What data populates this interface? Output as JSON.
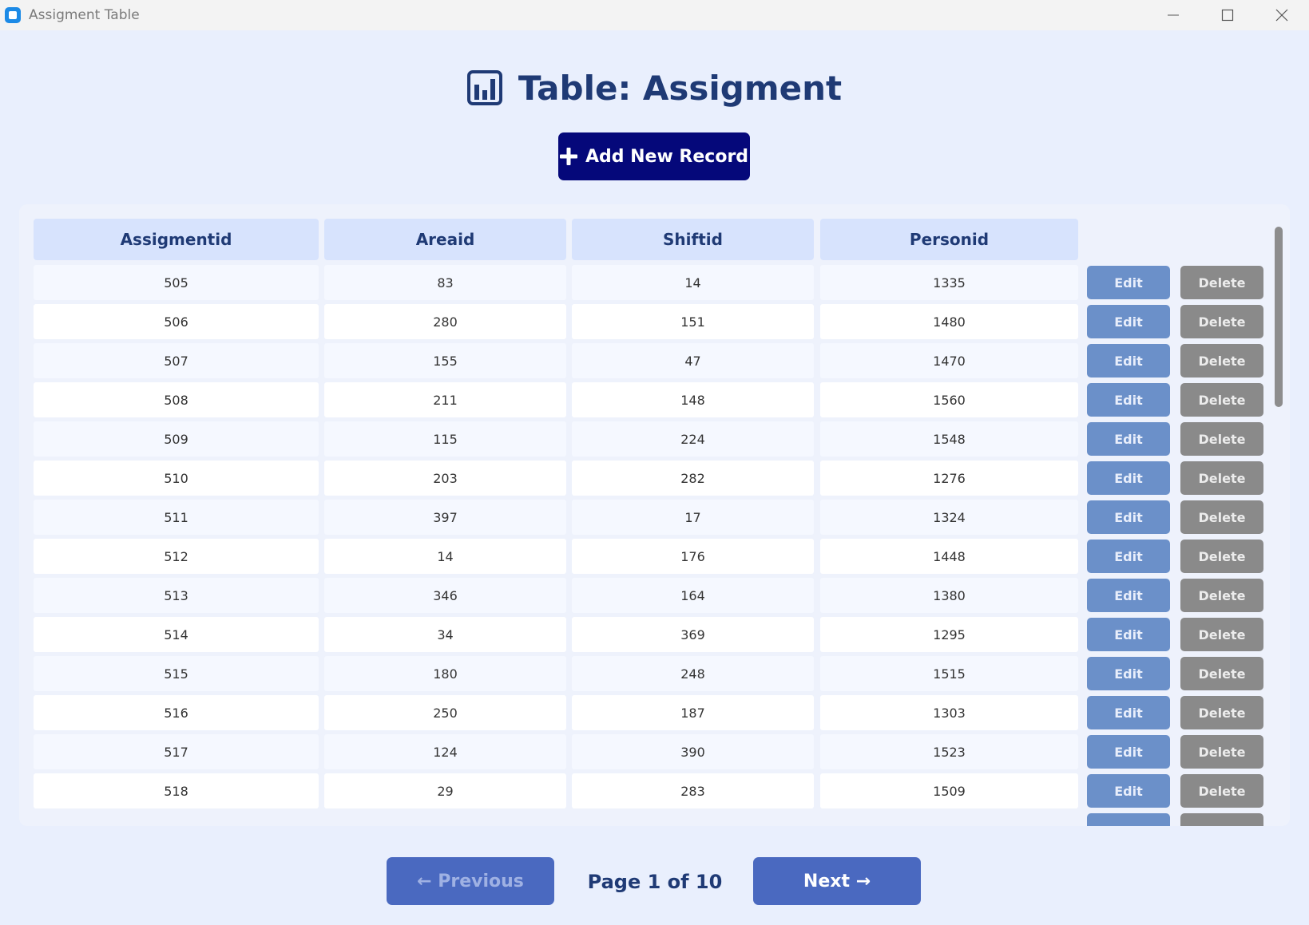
{
  "window": {
    "title": "Assigment Table"
  },
  "header": {
    "icon": "bar-chart-icon",
    "title": "Table: Assigment"
  },
  "toolbar": {
    "add_label": "Add New Record",
    "add_icon": "plus-icon"
  },
  "table": {
    "columns": [
      "Assigmentid",
      "Areaid",
      "Shiftid",
      "Personid"
    ],
    "rows": [
      {
        "assigmentid": "505",
        "areaid": "83",
        "shiftid": "14",
        "personid": "1335",
        "edit": "Edit",
        "delete": "Delete"
      },
      {
        "assigmentid": "506",
        "areaid": "280",
        "shiftid": "151",
        "personid": "1480",
        "edit": "Edit",
        "delete": "Delete"
      },
      {
        "assigmentid": "507",
        "areaid": "155",
        "shiftid": "47",
        "personid": "1470",
        "edit": "Edit",
        "delete": "Delete"
      },
      {
        "assigmentid": "508",
        "areaid": "211",
        "shiftid": "148",
        "personid": "1560",
        "edit": "Edit",
        "delete": "Delete"
      },
      {
        "assigmentid": "509",
        "areaid": "115",
        "shiftid": "224",
        "personid": "1548",
        "edit": "Edit",
        "delete": "Delete"
      },
      {
        "assigmentid": "510",
        "areaid": "203",
        "shiftid": "282",
        "personid": "1276",
        "edit": "Edit",
        "delete": "Delete"
      },
      {
        "assigmentid": "511",
        "areaid": "397",
        "shiftid": "17",
        "personid": "1324",
        "edit": "Edit",
        "delete": "Delete"
      },
      {
        "assigmentid": "512",
        "areaid": "14",
        "shiftid": "176",
        "personid": "1448",
        "edit": "Edit",
        "delete": "Delete"
      },
      {
        "assigmentid": "513",
        "areaid": "346",
        "shiftid": "164",
        "personid": "1380",
        "edit": "Edit",
        "delete": "Delete"
      },
      {
        "assigmentid": "514",
        "areaid": "34",
        "shiftid": "369",
        "personid": "1295",
        "edit": "Edit",
        "delete": "Delete"
      },
      {
        "assigmentid": "515",
        "areaid": "180",
        "shiftid": "248",
        "personid": "1515",
        "edit": "Edit",
        "delete": "Delete"
      },
      {
        "assigmentid": "516",
        "areaid": "250",
        "shiftid": "187",
        "personid": "1303",
        "edit": "Edit",
        "delete": "Delete"
      },
      {
        "assigmentid": "517",
        "areaid": "124",
        "shiftid": "390",
        "personid": "1523",
        "edit": "Edit",
        "delete": "Delete"
      },
      {
        "assigmentid": "518",
        "areaid": "29",
        "shiftid": "283",
        "personid": "1509",
        "edit": "Edit",
        "delete": "Delete"
      }
    ]
  },
  "pagination": {
    "previous_label": "← Previous",
    "page_label": "Page 1 of 10",
    "next_label": "Next →"
  },
  "colors": {
    "background": "#e9effd",
    "primary": "#05087a",
    "header_cell": "#d7e3fd",
    "edit_button": "#6b90c9",
    "delete_button": "#8a8a8a",
    "pager_button": "#4a69c0",
    "heading_text": "#1f3a75"
  }
}
